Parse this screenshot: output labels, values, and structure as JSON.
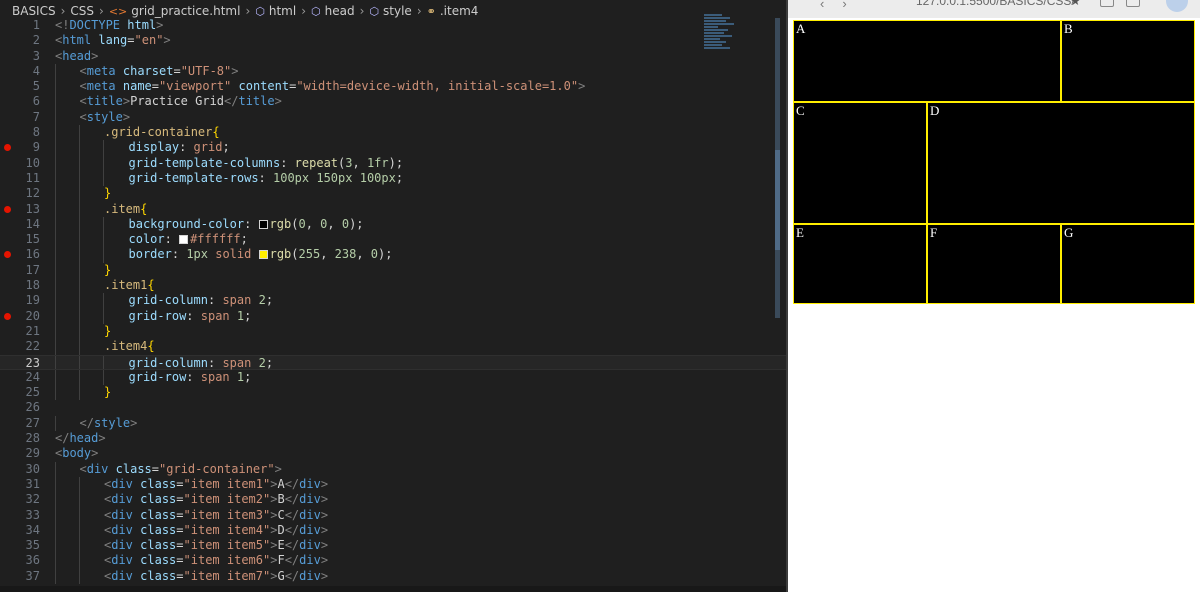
{
  "breadcrumb": [
    {
      "label": "BASICS",
      "icon": ""
    },
    {
      "label": "CSS",
      "icon": ""
    },
    {
      "label": "grid_practice.html",
      "icon": "html-file-icon"
    },
    {
      "label": "html",
      "icon": "element-cube-icon"
    },
    {
      "label": "head",
      "icon": "element-cube-icon"
    },
    {
      "label": "style",
      "icon": "element-cube-icon"
    },
    {
      "label": ".item4",
      "icon": "css-selector-icon"
    }
  ],
  "editor": {
    "active_line": 23,
    "breakpoint_lines": [
      9,
      13,
      16,
      20
    ],
    "lines": [
      {
        "n": "1",
        "i": 1,
        "t": [
          [
            "tag",
            "<!"
          ],
          [
            "name",
            "DOCTYPE"
          ],
          [
            "text",
            " "
          ],
          [
            "attr",
            "html"
          ],
          [
            "tag",
            ">"
          ]
        ]
      },
      {
        "n": "2",
        "i": 1,
        "t": [
          [
            "tag",
            "<"
          ],
          [
            "name",
            "html"
          ],
          [
            "text",
            " "
          ],
          [
            "attr",
            "lang"
          ],
          [
            "text",
            "="
          ],
          [
            "str",
            "\"en\""
          ],
          [
            "tag",
            ">"
          ]
        ]
      },
      {
        "n": "3",
        "i": 1,
        "t": [
          [
            "tag",
            "<"
          ],
          [
            "name",
            "head"
          ],
          [
            "tag",
            ">"
          ]
        ]
      },
      {
        "n": "4",
        "i": 2,
        "t": [
          [
            "tag",
            "<"
          ],
          [
            "name",
            "meta"
          ],
          [
            "text",
            " "
          ],
          [
            "attr",
            "charset"
          ],
          [
            "text",
            "="
          ],
          [
            "str",
            "\"UTF-8\""
          ],
          [
            "tag",
            ">"
          ]
        ]
      },
      {
        "n": "5",
        "i": 2,
        "t": [
          [
            "tag",
            "<"
          ],
          [
            "name",
            "meta"
          ],
          [
            "text",
            " "
          ],
          [
            "attr",
            "name"
          ],
          [
            "text",
            "="
          ],
          [
            "str",
            "\"viewport\""
          ],
          [
            "text",
            " "
          ],
          [
            "attr",
            "content"
          ],
          [
            "text",
            "="
          ],
          [
            "str",
            "\"width=device-width, initial-scale=1.0\""
          ],
          [
            "tag",
            ">"
          ]
        ]
      },
      {
        "n": "6",
        "i": 2,
        "t": [
          [
            "tag",
            "<"
          ],
          [
            "name",
            "title"
          ],
          [
            "tag",
            ">"
          ],
          [
            "text",
            "Practice Grid"
          ],
          [
            "tag",
            "</"
          ],
          [
            "name",
            "title"
          ],
          [
            "tag",
            ">"
          ]
        ]
      },
      {
        "n": "7",
        "i": 2,
        "t": [
          [
            "tag",
            "<"
          ],
          [
            "name",
            "style"
          ],
          [
            "tag",
            ">"
          ]
        ]
      },
      {
        "n": "8",
        "i": 3,
        "t": [
          [
            "sel",
            ".grid-container"
          ],
          [
            "brace",
            "{"
          ]
        ]
      },
      {
        "n": "9",
        "i": 4,
        "t": [
          [
            "prop",
            "display"
          ],
          [
            "text",
            ": "
          ],
          [
            "val",
            "grid"
          ],
          [
            "text",
            ";"
          ]
        ]
      },
      {
        "n": "10",
        "i": 4,
        "t": [
          [
            "prop",
            "grid-template-columns"
          ],
          [
            "text",
            ": "
          ],
          [
            "fn",
            "repeat"
          ],
          [
            "text",
            "("
          ],
          [
            "num",
            "3"
          ],
          [
            "text",
            ", "
          ],
          [
            "num",
            "1fr"
          ],
          [
            "text",
            ");"
          ]
        ]
      },
      {
        "n": "11",
        "i": 4,
        "t": [
          [
            "prop",
            "grid-template-rows"
          ],
          [
            "text",
            ": "
          ],
          [
            "num",
            "100px"
          ],
          [
            "text",
            " "
          ],
          [
            "num",
            "150px"
          ],
          [
            "text",
            " "
          ],
          [
            "num",
            "100px"
          ],
          [
            "text",
            ";"
          ]
        ]
      },
      {
        "n": "12",
        "i": 3,
        "t": [
          [
            "brace",
            "}"
          ]
        ]
      },
      {
        "n": "13",
        "i": 3,
        "t": [
          [
            "sel",
            ".item"
          ],
          [
            "brace",
            "{"
          ]
        ]
      },
      {
        "n": "14",
        "i": 4,
        "t": [
          [
            "prop",
            "background-color"
          ],
          [
            "text",
            ": "
          ],
          [
            "swatch",
            "#000000"
          ],
          [
            "fn",
            "rgb"
          ],
          [
            "text",
            "("
          ],
          [
            "num",
            "0"
          ],
          [
            "text",
            ", "
          ],
          [
            "num",
            "0"
          ],
          [
            "text",
            ", "
          ],
          [
            "num",
            "0"
          ],
          [
            "text",
            ");"
          ]
        ]
      },
      {
        "n": "15",
        "i": 4,
        "t": [
          [
            "prop",
            "color"
          ],
          [
            "text",
            ": "
          ],
          [
            "swatch",
            "#ffffff"
          ],
          [
            "val",
            "#ffffff"
          ],
          [
            "text",
            ";"
          ]
        ]
      },
      {
        "n": "16",
        "i": 4,
        "t": [
          [
            "prop",
            "border"
          ],
          [
            "text",
            ": "
          ],
          [
            "num",
            "1px"
          ],
          [
            "text",
            " "
          ],
          [
            "val",
            "solid"
          ],
          [
            "text",
            " "
          ],
          [
            "swatch",
            "#ffee00"
          ],
          [
            "fn",
            "rgb"
          ],
          [
            "text",
            "("
          ],
          [
            "num",
            "255"
          ],
          [
            "text",
            ", "
          ],
          [
            "num",
            "238"
          ],
          [
            "text",
            ", "
          ],
          [
            "num",
            "0"
          ],
          [
            "text",
            ");"
          ]
        ]
      },
      {
        "n": "17",
        "i": 3,
        "t": [
          [
            "brace",
            "}"
          ]
        ]
      },
      {
        "n": "18",
        "i": 3,
        "t": [
          [
            "sel",
            ".item1"
          ],
          [
            "brace",
            "{"
          ]
        ]
      },
      {
        "n": "19",
        "i": 4,
        "t": [
          [
            "prop",
            "grid-column"
          ],
          [
            "text",
            ": "
          ],
          [
            "val",
            "span"
          ],
          [
            "text",
            " "
          ],
          [
            "num",
            "2"
          ],
          [
            "text",
            ";"
          ]
        ]
      },
      {
        "n": "20",
        "i": 4,
        "t": [
          [
            "prop",
            "grid-row"
          ],
          [
            "text",
            ": "
          ],
          [
            "val",
            "span"
          ],
          [
            "text",
            " "
          ],
          [
            "num",
            "1"
          ],
          [
            "text",
            ";"
          ]
        ]
      },
      {
        "n": "21",
        "i": 3,
        "t": [
          [
            "brace",
            "}"
          ]
        ]
      },
      {
        "n": "22",
        "i": 3,
        "t": [
          [
            "sel",
            ".item4"
          ],
          [
            "brace",
            "{"
          ]
        ]
      },
      {
        "n": "23",
        "i": 4,
        "t": [
          [
            "prop",
            "grid-column"
          ],
          [
            "text",
            ": "
          ],
          [
            "val",
            "span"
          ],
          [
            "text",
            " "
          ],
          [
            "num",
            "2"
          ],
          [
            "text",
            ";"
          ]
        ]
      },
      {
        "n": "24",
        "i": 4,
        "t": [
          [
            "prop",
            "grid-row"
          ],
          [
            "text",
            ": "
          ],
          [
            "val",
            "span"
          ],
          [
            "text",
            " "
          ],
          [
            "num",
            "1"
          ],
          [
            "text",
            ";"
          ]
        ]
      },
      {
        "n": "25",
        "i": 3,
        "t": [
          [
            "brace",
            "}"
          ]
        ]
      },
      {
        "n": "26",
        "i": 1,
        "t": []
      },
      {
        "n": "27",
        "i": 2,
        "t": [
          [
            "tag",
            "</"
          ],
          [
            "name",
            "style"
          ],
          [
            "tag",
            ">"
          ]
        ]
      },
      {
        "n": "28",
        "i": 1,
        "t": [
          [
            "tag",
            "</"
          ],
          [
            "name",
            "head"
          ],
          [
            "tag",
            ">"
          ]
        ]
      },
      {
        "n": "29",
        "i": 1,
        "t": [
          [
            "tag",
            "<"
          ],
          [
            "name",
            "body"
          ],
          [
            "tag",
            ">"
          ]
        ]
      },
      {
        "n": "30",
        "i": 2,
        "t": [
          [
            "tag",
            "<"
          ],
          [
            "name",
            "div"
          ],
          [
            "text",
            " "
          ],
          [
            "attr",
            "class"
          ],
          [
            "text",
            "="
          ],
          [
            "str",
            "\"grid-container\""
          ],
          [
            "tag",
            ">"
          ]
        ]
      },
      {
        "n": "31",
        "i": 3,
        "t": [
          [
            "tag",
            "<"
          ],
          [
            "name",
            "div"
          ],
          [
            "text",
            " "
          ],
          [
            "attr",
            "class"
          ],
          [
            "text",
            "="
          ],
          [
            "str",
            "\"item item1\""
          ],
          [
            "tag",
            ">"
          ],
          [
            "text",
            "A"
          ],
          [
            "tag",
            "</"
          ],
          [
            "name",
            "div"
          ],
          [
            "tag",
            ">"
          ]
        ]
      },
      {
        "n": "32",
        "i": 3,
        "t": [
          [
            "tag",
            "<"
          ],
          [
            "name",
            "div"
          ],
          [
            "text",
            " "
          ],
          [
            "attr",
            "class"
          ],
          [
            "text",
            "="
          ],
          [
            "str",
            "\"item item2\""
          ],
          [
            "tag",
            ">"
          ],
          [
            "text",
            "B"
          ],
          [
            "tag",
            "</"
          ],
          [
            "name",
            "div"
          ],
          [
            "tag",
            ">"
          ]
        ]
      },
      {
        "n": "33",
        "i": 3,
        "t": [
          [
            "tag",
            "<"
          ],
          [
            "name",
            "div"
          ],
          [
            "text",
            " "
          ],
          [
            "attr",
            "class"
          ],
          [
            "text",
            "="
          ],
          [
            "str",
            "\"item item3\""
          ],
          [
            "tag",
            ">"
          ],
          [
            "text",
            "C"
          ],
          [
            "tag",
            "</"
          ],
          [
            "name",
            "div"
          ],
          [
            "tag",
            ">"
          ]
        ]
      },
      {
        "n": "34",
        "i": 3,
        "t": [
          [
            "tag",
            "<"
          ],
          [
            "name",
            "div"
          ],
          [
            "text",
            " "
          ],
          [
            "attr",
            "class"
          ],
          [
            "text",
            "="
          ],
          [
            "str",
            "\"item item4\""
          ],
          [
            "tag",
            ">"
          ],
          [
            "text",
            "D"
          ],
          [
            "tag",
            "</"
          ],
          [
            "name",
            "div"
          ],
          [
            "tag",
            ">"
          ]
        ]
      },
      {
        "n": "35",
        "i": 3,
        "t": [
          [
            "tag",
            "<"
          ],
          [
            "name",
            "div"
          ],
          [
            "text",
            " "
          ],
          [
            "attr",
            "class"
          ],
          [
            "text",
            "="
          ],
          [
            "str",
            "\"item item5\""
          ],
          [
            "tag",
            ">"
          ],
          [
            "text",
            "E"
          ],
          [
            "tag",
            "</"
          ],
          [
            "name",
            "div"
          ],
          [
            "tag",
            ">"
          ]
        ]
      },
      {
        "n": "36",
        "i": 3,
        "t": [
          [
            "tag",
            "<"
          ],
          [
            "name",
            "div"
          ],
          [
            "text",
            " "
          ],
          [
            "attr",
            "class"
          ],
          [
            "text",
            "="
          ],
          [
            "str",
            "\"item item6\""
          ],
          [
            "tag",
            ">"
          ],
          [
            "text",
            "F"
          ],
          [
            "tag",
            "</"
          ],
          [
            "name",
            "div"
          ],
          [
            "tag",
            ">"
          ]
        ]
      },
      {
        "n": "37",
        "i": 3,
        "t": [
          [
            "tag",
            "<"
          ],
          [
            "name",
            "div"
          ],
          [
            "text",
            " "
          ],
          [
            "attr",
            "class"
          ],
          [
            "text",
            "="
          ],
          [
            "str",
            "\"item item7\""
          ],
          [
            "tag",
            ">"
          ],
          [
            "text",
            "G"
          ],
          [
            "tag",
            "</"
          ],
          [
            "name",
            "div"
          ],
          [
            "tag",
            ">"
          ]
        ]
      }
    ]
  },
  "preview": {
    "url_fragment": "127.0.0.1:5500/BASICS/CSS/",
    "items": [
      "A",
      "B",
      "C",
      "D",
      "E",
      "F",
      "G"
    ],
    "colors": {
      "item_bg": "#000000",
      "item_text": "#ffffff",
      "item_border": "#ffee00"
    }
  }
}
